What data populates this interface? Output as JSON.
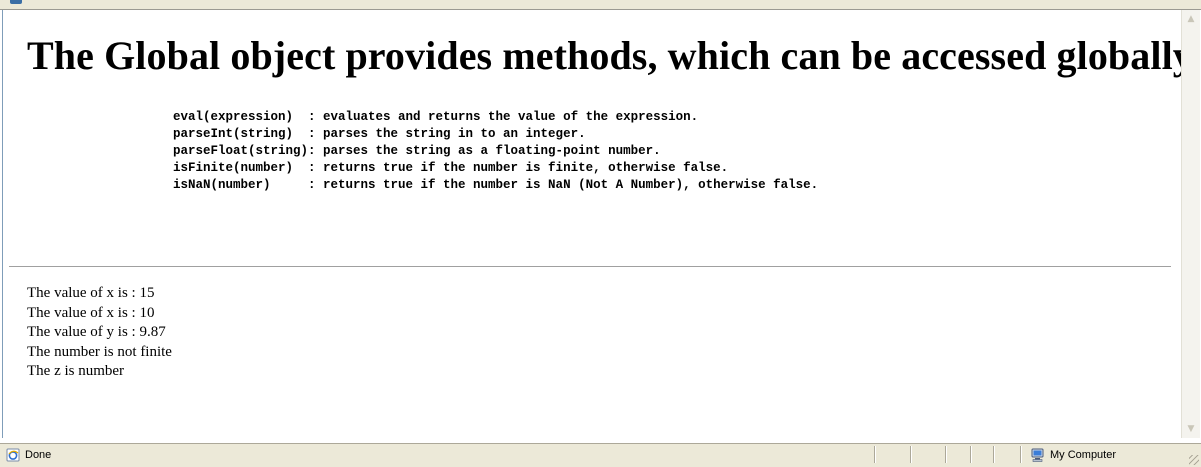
{
  "page": {
    "heading": "The Global object provides methods, which can be accessed globally",
    "methods": [
      "eval(expression)  : evaluates and returns the value of the expression.",
      "parseInt(string)  : parses the string in to an integer.",
      "parseFloat(string): parses the string as a floating-point number.",
      "isFinite(number)  : returns true if the number is finite, otherwise false.",
      "isNaN(number)     : returns true if the number is NaN (Not A Number), otherwise false."
    ],
    "output": [
      "The value of x is : 15",
      "The value of x is : 10",
      "The value of y is : 9.87",
      "The number is not finite",
      "The z is number"
    ]
  },
  "statusbar": {
    "status_text": "Done",
    "zone_text": "My Computer",
    "icons": [
      "ie-page-icon",
      "my-computer-icon"
    ]
  },
  "colors": {
    "chrome": "#ece9d8",
    "chrome_border": "#aca899",
    "rule": "#a0a0a0",
    "text": "#000000"
  }
}
